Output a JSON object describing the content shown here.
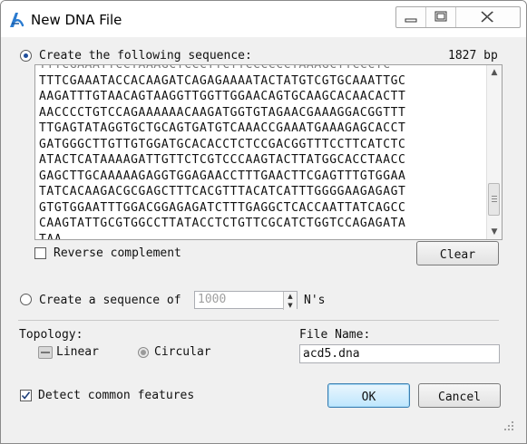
{
  "window": {
    "title": "New DNA File"
  },
  "create_sequence": {
    "label": "Create the following sequence:",
    "length": "1827 bp",
    "selected": true,
    "partial_top_line": "TTTCGAAATTCCTAAAGCTCCCTTCTTCCCCCCTAAAGCTTCCCTC",
    "lines": [
      "TTTCGAAATACCACAAGATCAGAGAAAATACTATGTCGTGCAAATTGC",
      "AAGATTTGTAACAGTAAGGTTGGTTGGAACAGTGCAAGCACAACACTT",
      "AACCCCTGTCCAGAAAAAACAAGATGGTGTAGAACGAAAGGACGGTTT",
      "TTGAGTATAGGTGCTGCAGTGATGTCAAACCGAAATGAAAGAGCACCT",
      "GATGGGCTTGTTGTGGATGCACACCTCTCCGACGGTTTCCTTCATCTC",
      "ATACTCATAAAAGATTGTTCTCGTCCCAAGTACTTATGGCACCTAACC",
      "GAGCTTGCAAAAAGAGGTGGAGAACCTTTGAACTTCGAGTTTGTGGAA",
      "TATCACAAGACGCGAGCTTTCACGTTTACATCATTTGGGGAAGAGAGT",
      "GTGTGGAATTTGGACGGAGAGATCTTTGAGGCTCACCAATTATCAGCC",
      "CAAGTATTGCGTGGCCTTATACCTCTGTTCGCATCTGGTCCAGAGATA",
      "TAA"
    ]
  },
  "reverse_complement": {
    "label": "Reverse complement",
    "checked": false
  },
  "clear_button": {
    "label": "Clear"
  },
  "create_ns": {
    "label_prefix": "Create a sequence of",
    "count": "1000",
    "label_suffix": "N's",
    "selected": false
  },
  "topology": {
    "label": "Topology:",
    "linear_label": "Linear",
    "circular_label": "Circular",
    "selected": "Linear"
  },
  "file_name": {
    "label": "File Name:",
    "value": "acd5.dna"
  },
  "detect_features": {
    "label": "Detect common features",
    "checked": true
  },
  "ok_button": {
    "label": "OK"
  },
  "cancel_button": {
    "label": "Cancel"
  },
  "colors": {
    "accent": "#3c7fb1",
    "radio_dot": "#1f4e9c",
    "window_bg": "#f0f0f0"
  }
}
